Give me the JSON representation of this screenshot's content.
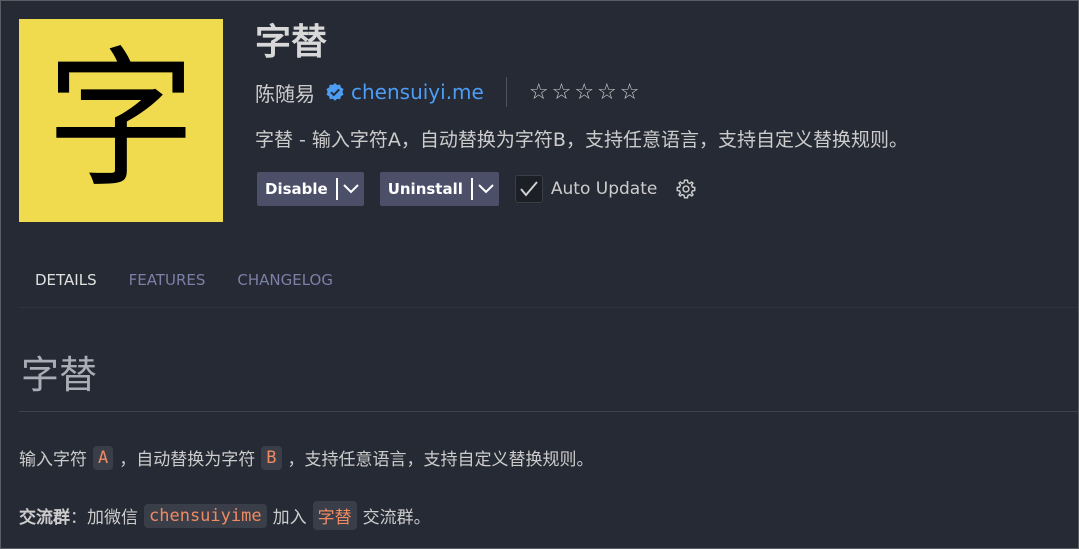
{
  "extension": {
    "icon_char": "字",
    "icon_bg": "#f0da4e",
    "name": "字替",
    "publisher": "陈随易",
    "verified_icon": "verified-badge-icon",
    "domain": "chensuiyi.me",
    "rating_stars": 0,
    "description": "字替 - 输入字符A，自动替换为字符B，支持任意语言，支持自定义替换规则。"
  },
  "actions": {
    "disable_label": "Disable",
    "uninstall_label": "Uninstall",
    "auto_update_label": "Auto Update",
    "auto_update_checked": true,
    "settings_icon": "gear-icon"
  },
  "tabs": [
    {
      "label": "DETAILS",
      "active": true
    },
    {
      "label": "FEATURES",
      "active": false
    },
    {
      "label": "CHANGELOG",
      "active": false
    }
  ],
  "readme": {
    "heading": "字替",
    "para1": {
      "t1": "输入字符",
      "code1": "A",
      "t2": "，自动替换为字符",
      "code2": "B",
      "t3": "，支持任意语言，支持自定义替换规则。"
    },
    "para2": {
      "bold": "交流群",
      "t1": "：加微信",
      "code1": "chensuiyime",
      "t2": "加入",
      "code2": "字替",
      "t3": "交流群。"
    }
  },
  "colors": {
    "background": "#262a35",
    "accent_link": "#4d9df5",
    "button_bg": "#4b5068",
    "code_text": "#ef8a63"
  }
}
